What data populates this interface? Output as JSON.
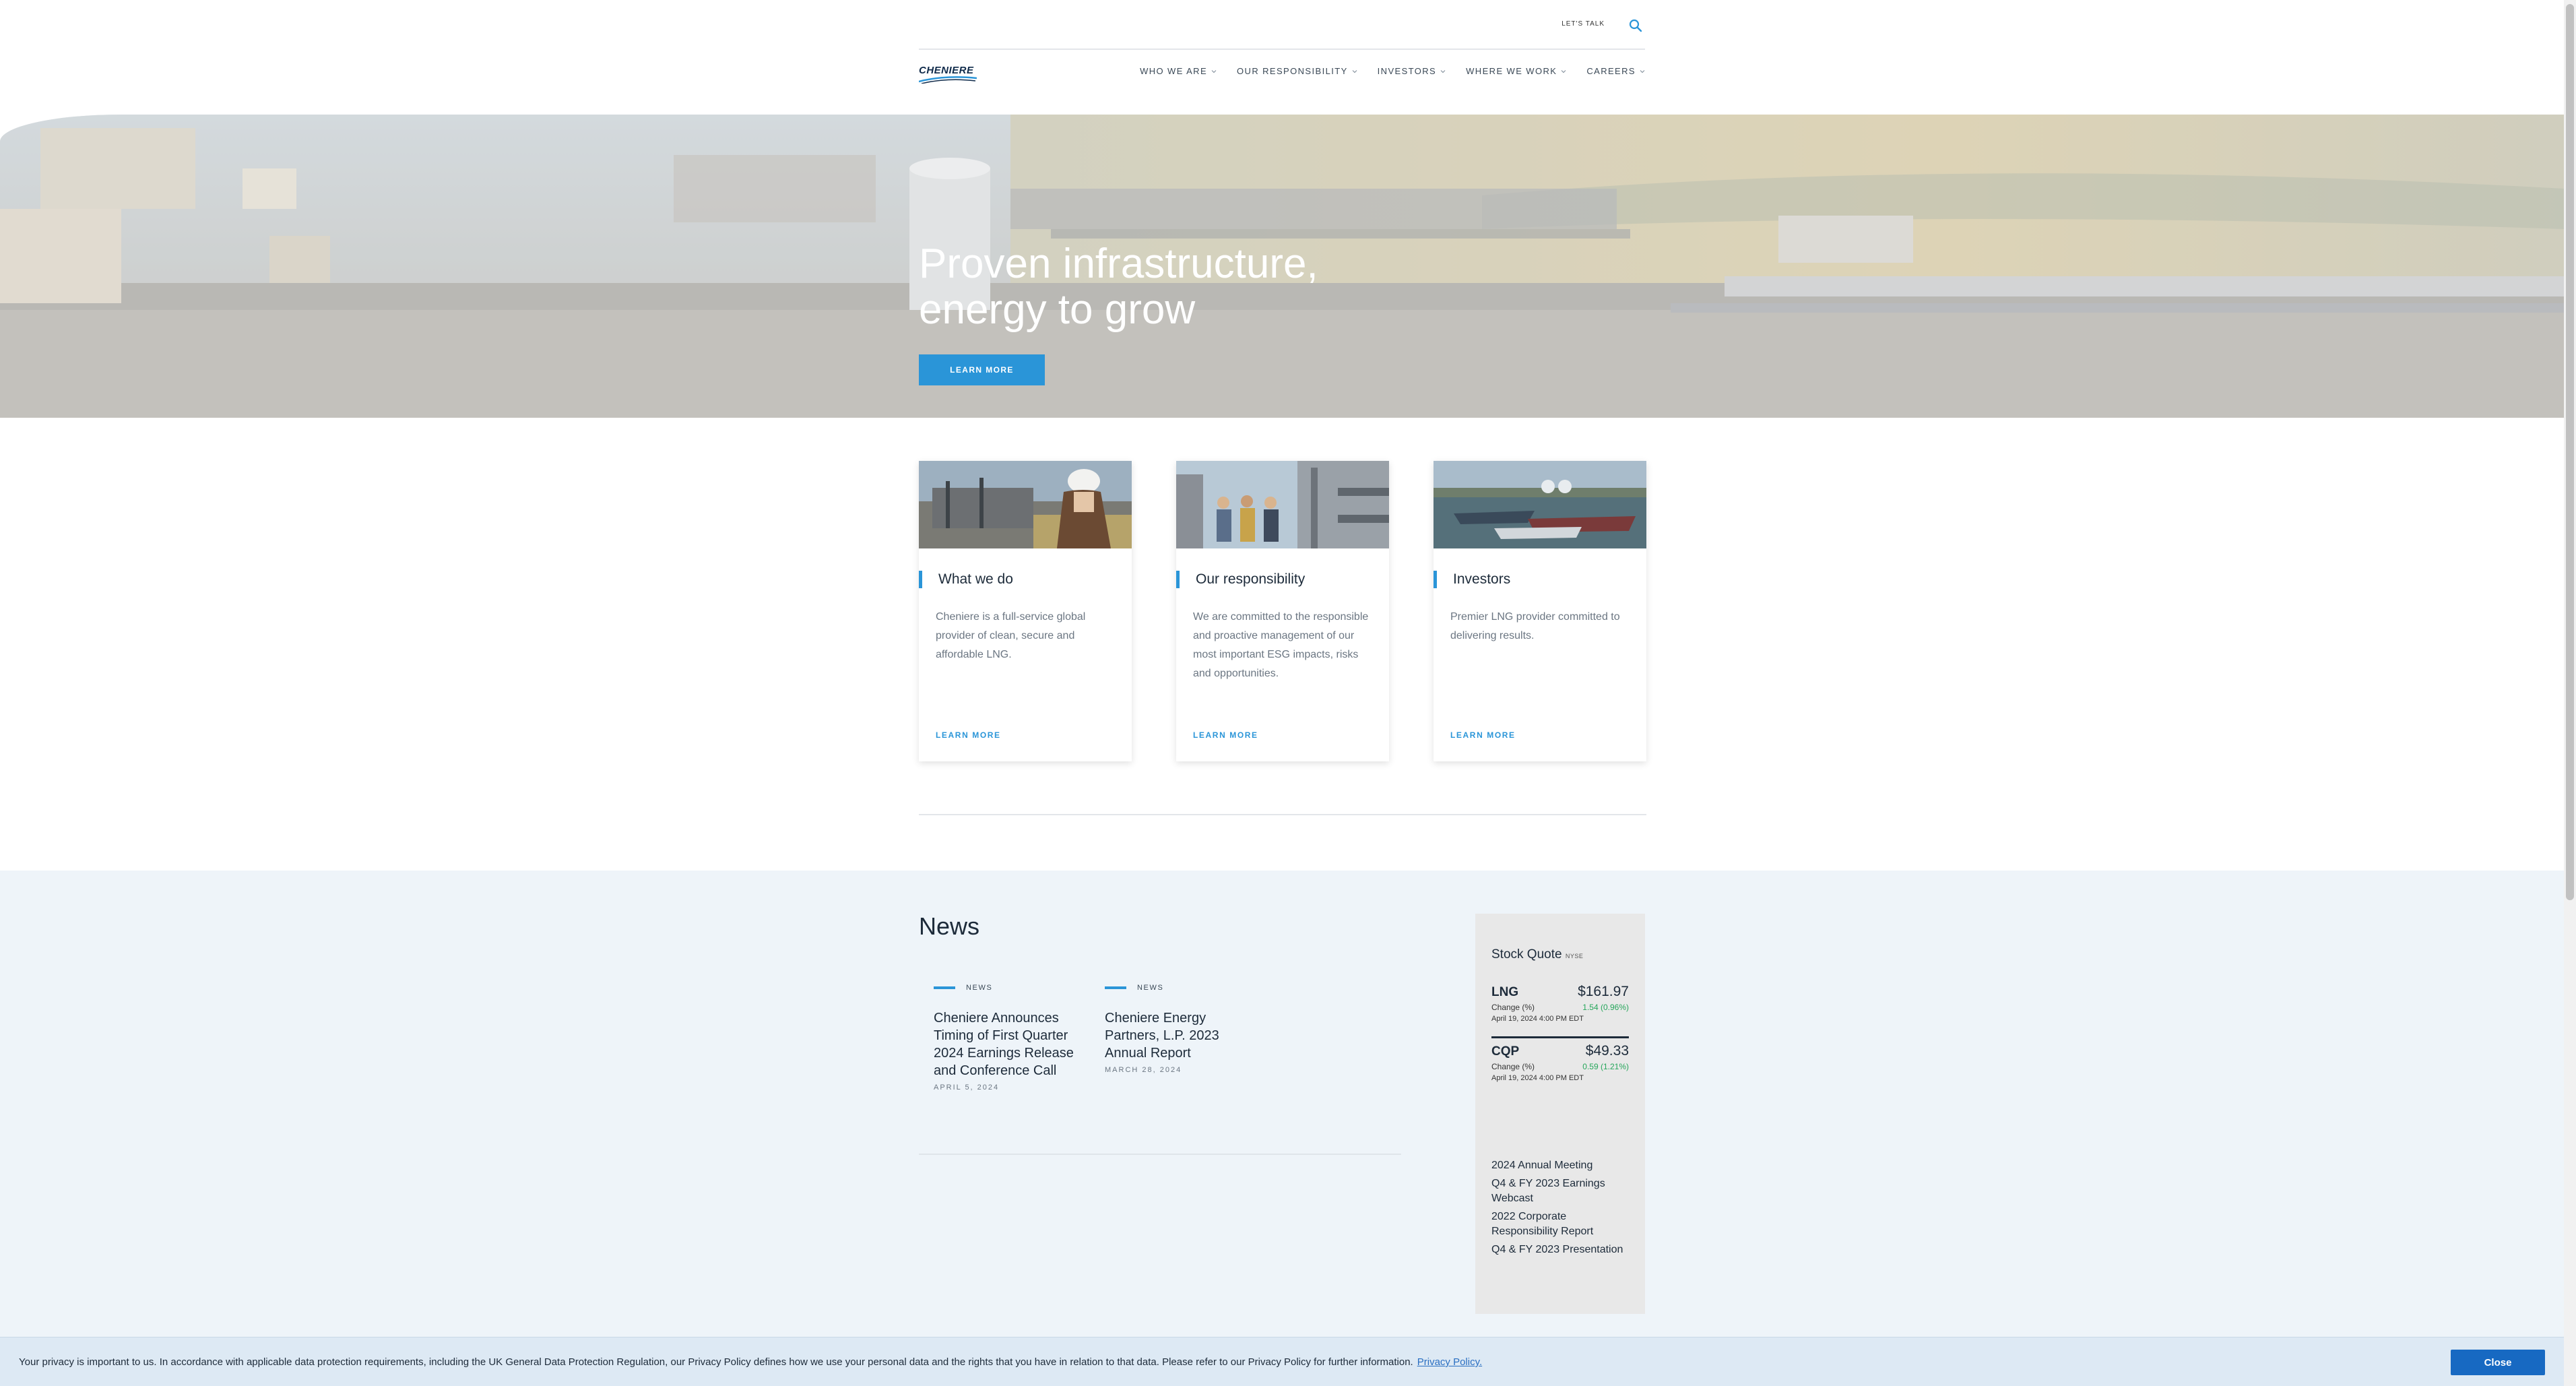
{
  "header": {
    "lets_talk": "LET'S TALK",
    "search_icon": "search-icon",
    "logo_text": "CHENIERE",
    "nav": [
      {
        "label": "WHO WE ARE"
      },
      {
        "label": "OUR RESPONSIBILITY"
      },
      {
        "label": "INVESTORS"
      },
      {
        "label": "WHERE WE WORK"
      },
      {
        "label": "CAREERS"
      }
    ]
  },
  "hero": {
    "title_line1": "Proven infrastructure,",
    "title_line2": "energy to grow",
    "button": "LEARN MORE"
  },
  "cards": [
    {
      "title": "What we do",
      "text": "Cheniere is a full-service global provider of clean, secure and affordable LNG.",
      "link": "LEARN MORE"
    },
    {
      "title": "Our responsibility",
      "text": "We are committed to the responsible and proactive management of our most important ESG impacts, risks and opportunities.",
      "link": "LEARN MORE"
    },
    {
      "title": "Investors",
      "text": "Premier LNG provider committed to delivering results.",
      "link": "LEARN MORE"
    }
  ],
  "news": {
    "heading": "News",
    "items": [
      {
        "tag": "NEWS",
        "title": "Cheniere Announces Timing of First Quarter 2024 Earnings Release and Conference Call",
        "date": "APRIL 5, 2024"
      },
      {
        "tag": "NEWS",
        "title": "Cheniere Energy Partners, L.P. 2023 Annual Report",
        "date": "MARCH 28, 2024"
      }
    ]
  },
  "stock": {
    "title": "Stock Quote",
    "exchange": "NYSE",
    "quotes": [
      {
        "ticker": "LNG",
        "price": "$161.97",
        "change_label": "Change (%)",
        "change": "1.54 (0.96%)",
        "date": "April 19, 2024 4:00 PM EDT"
      },
      {
        "ticker": "CQP",
        "price": "$49.33",
        "change_label": "Change (%)",
        "change": "0.59 (1.21%)",
        "date": "April 19, 2024 4:00 PM EDT"
      }
    ],
    "links": [
      "2024 Annual Meeting",
      "Q4 & FY 2023 Earnings Webcast",
      "2022 Corporate Responsibility Report",
      "Q4 & FY 2023 Presentation"
    ]
  },
  "cookie": {
    "text": "Your privacy is important to us. In accordance with applicable data protection requirements, including the UK General Data Protection Regulation, our Privacy Policy defines how we use your personal data and the rights that you have in relation to that data. Please refer to our Privacy Policy for further information.",
    "link": "Privacy Policy.",
    "close": "Close"
  },
  "colors": {
    "accent": "#2a95d8",
    "navy": "#1d2b3a",
    "positive": "#26a65b",
    "news_bg": "#eef4f9",
    "cookie_button": "#1769c2"
  }
}
